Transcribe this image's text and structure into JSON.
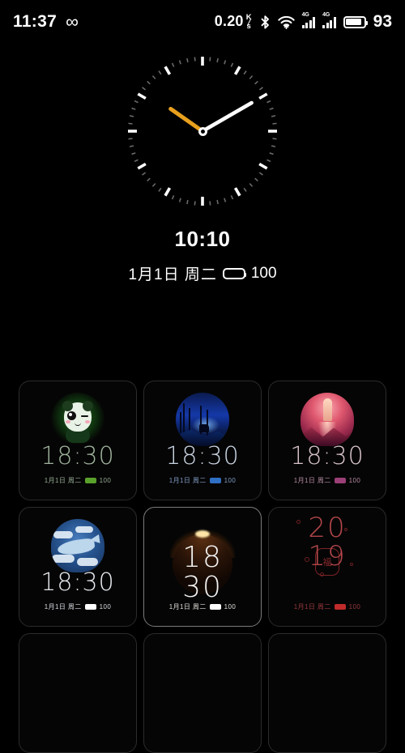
{
  "statusbar": {
    "time": "11:37",
    "infinity_icon": "infinity-icon",
    "network_speed": "0.20",
    "network_speed_unit_top": "K",
    "network_speed_unit_bottom": "s",
    "bluetooth_icon": "bluetooth-icon",
    "wifi_icon": "wifi-icon",
    "signal_1_label": "4G",
    "signal_2_label": "4G",
    "battery_icon": "battery-icon",
    "battery_level": "93"
  },
  "preview": {
    "analog_clock_name": "analog-clock",
    "hour_hand_color": "#e8a01e",
    "minute_hand_color": "#ffffff",
    "digital_time": "10:10",
    "date": "1月1日 周二",
    "battery_level": "100"
  },
  "faces": [
    {
      "name": "panda-watchface",
      "time": "18:30",
      "date": "1月1日 周二",
      "battery_level": "100",
      "time_color": "#9fb39c",
      "date_color": "#96ab93",
      "battery_color": "#5aa12c",
      "art": "panda",
      "selected": false
    },
    {
      "name": "forest-deer-watchface",
      "time": "18:30",
      "date": "1月1日 周二",
      "battery_level": "100",
      "time_color": "#c9d3e2",
      "date_color": "#7f9cc4",
      "battery_color": "#2f6fc4",
      "art": "forest",
      "selected": false
    },
    {
      "name": "rocket-watchface",
      "time": "18:30",
      "date": "1月1日 周二",
      "battery_level": "100",
      "time_color": "#d8c3cb",
      "date_color": "#b58aa0",
      "battery_color": "#9b3f77",
      "art": "rocket",
      "selected": false
    },
    {
      "name": "whale-watchface",
      "time": "18:30",
      "date": "1月1日 周二",
      "battery_level": "100",
      "time_color": "#e6e9ee",
      "date_color": "#d7dbe2",
      "battery_color": "#ffffff",
      "art": "whale",
      "selected": false
    },
    {
      "name": "eclipse-watchface",
      "time_line1": "18",
      "time_line2": "30",
      "date": "1月1日 周二",
      "battery_level": "100",
      "time_color": "#f2f2f2",
      "date_color": "#e0ddd8",
      "battery_color": "#ffffff",
      "art": "eclipse",
      "selected": true
    },
    {
      "name": "newyear-2019-watchface",
      "time_line1": "20",
      "time_line2": "19",
      "date": "1月1日 周二",
      "battery_level": "100",
      "time_color": "#b2464a",
      "date_color": "#97383c",
      "battery_color": "#c02a2a",
      "art": "newyear",
      "selected": false
    },
    {
      "name": "empty-watchface-slot-1",
      "art": "empty",
      "selected": false
    },
    {
      "name": "empty-watchface-slot-2",
      "art": "empty",
      "selected": false
    },
    {
      "name": "empty-watchface-slot-3",
      "art": "empty",
      "selected": false
    }
  ]
}
